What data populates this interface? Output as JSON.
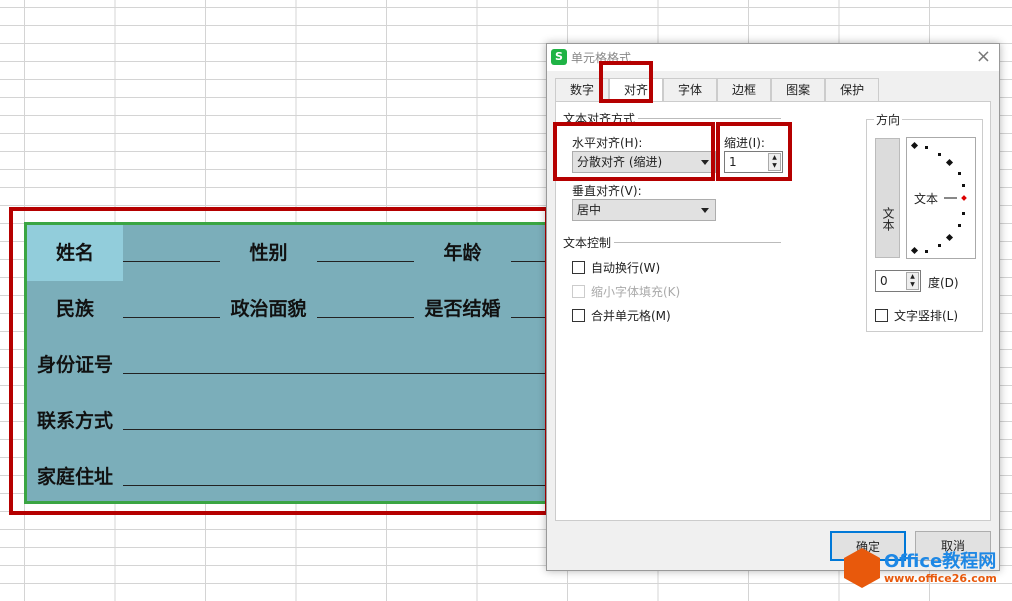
{
  "form": {
    "rows": [
      [
        "姓名",
        "性别",
        "年龄"
      ],
      [
        "民族",
        "政治面貌",
        "是否结婚"
      ],
      [
        "身份证号"
      ],
      [
        "联系方式"
      ],
      [
        "家庭住址"
      ]
    ]
  },
  "dialog": {
    "title": "单元格格式",
    "close": "×",
    "logo": "S",
    "tabs": [
      "数字",
      "对齐",
      "字体",
      "边框",
      "图案",
      "保护"
    ],
    "text_align_section": "文本对齐方式",
    "horizontal_label": "水平对齐(H):",
    "horizontal_value": "分散对齐 (缩进)",
    "indent_label": "缩进(I):",
    "indent_value": "1",
    "vertical_label": "垂直对齐(V):",
    "vertical_value": "居中",
    "text_control_section": "文本控制",
    "wrap": "自动换行(W)",
    "shrink": "缩小字体填充(K)",
    "merge": "合并单元格(M)",
    "orientation_section": "方向",
    "vertical_text": "文本",
    "dial_text": "文本",
    "degree_value": "0",
    "degree_label": "度(D)",
    "vertical_stack": "文字竖排(L)",
    "ok": "确定",
    "cancel": "取消"
  },
  "watermark": {
    "name": "Office教程网",
    "url": "www.office26.com"
  },
  "colors": {
    "highlight": "#b50000",
    "selection": "#3aa543",
    "fill": "#7baeba"
  }
}
